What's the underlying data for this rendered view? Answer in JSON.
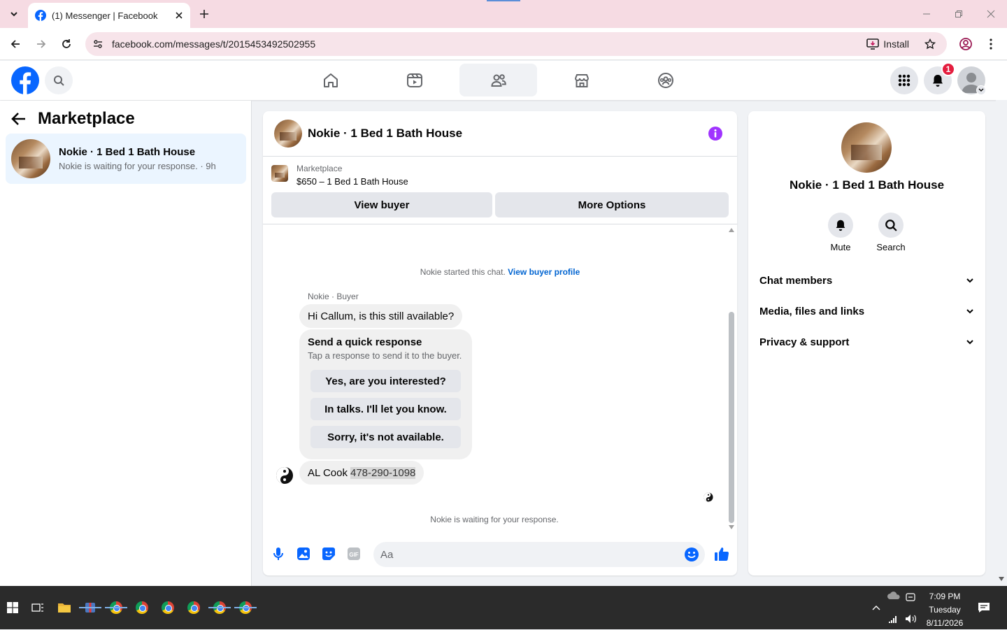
{
  "browser": {
    "tab_title": "(1) Messenger | Facebook",
    "url": "facebook.com/messages/t/2015453492502955",
    "install_label": "Install"
  },
  "fb": {
    "notification_count": "1"
  },
  "sidebar": {
    "title": "Marketplace",
    "conversation": {
      "name": "Nokie · 1 Bed 1 Bath House",
      "preview": "Nokie is waiting for your response. · 9h"
    }
  },
  "chat": {
    "title": "Nokie · 1 Bed 1 Bath House",
    "listing_source": "Marketplace",
    "listing_price": "$650 – 1 Bed 1 Bath House",
    "view_buyer_label": "View buyer",
    "more_options_label": "More Options",
    "started_text": "Nokie started this chat.",
    "view_profile_link": "View buyer profile",
    "sender_label": "Nokie · Buyer",
    "first_message": "Hi Callum, is this still available?",
    "quick_response": {
      "title": "Send a quick response",
      "subtitle": "Tap a response to send it to the buyer.",
      "options": [
        "Yes, are you interested?",
        "In talks. I'll let you know.",
        "Sorry, it's not available."
      ]
    },
    "reply_name": "AL Cook",
    "reply_phone": "478-290-1098",
    "waiting_text": "Nokie is waiting for your response.",
    "input_placeholder": "Aa"
  },
  "details": {
    "name": "Nokie · 1 Bed 1 Bath House",
    "mute_label": "Mute",
    "search_label": "Search",
    "sections": [
      "Chat members",
      "Media, files and links",
      "Privacy & support"
    ]
  },
  "taskbar": {
    "time": "7:09 PM",
    "day": "Tuesday",
    "date": "8/11/2026"
  },
  "colors": {
    "fb_blue": "#0866ff",
    "accent_purple": "#a033ff",
    "badge_red": "#e41e3f",
    "selected_convo": "#ebf5ff"
  }
}
